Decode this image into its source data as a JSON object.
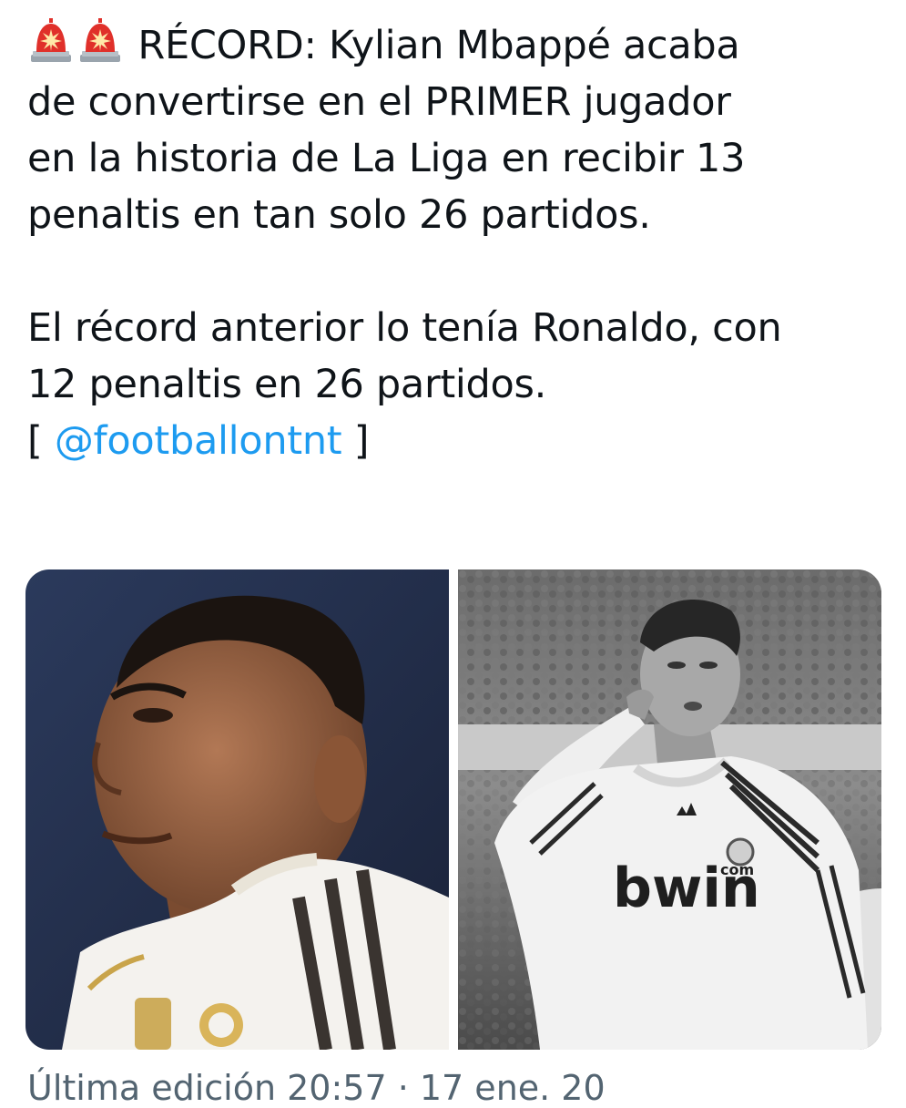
{
  "tweet": {
    "paragraph1": {
      "icons": [
        "police-siren-icon",
        "police-siren-icon"
      ],
      "line1": "RÉCORD: Kylian Mbappé acaba",
      "line2": "de convertirse en el PRIMER jugador",
      "line3": "en la historia de La Liga en recibir 13",
      "line4": "penaltis en tan solo 26 partidos."
    },
    "paragraph2": {
      "line1": "El récord anterior lo tenía Ronaldo, con",
      "line2": "12 penaltis en 26 partidos.",
      "bracket_open": "[ ",
      "mention": "@footballontnt",
      "bracket_close": " ]"
    }
  },
  "media": {
    "left_photo": {
      "jersey_brand": ""
    },
    "right_photo": {
      "jersey_sponsor": "bwin",
      "jersey_sponsor_suffix": "com"
    }
  },
  "footer": {
    "partial_text": "Última edición 20:57 · 17 ene. 20"
  },
  "colors": {
    "text": "#0f1419",
    "link": "#1d9bf0",
    "secondary": "#536471",
    "siren_red": "#e0302a"
  }
}
